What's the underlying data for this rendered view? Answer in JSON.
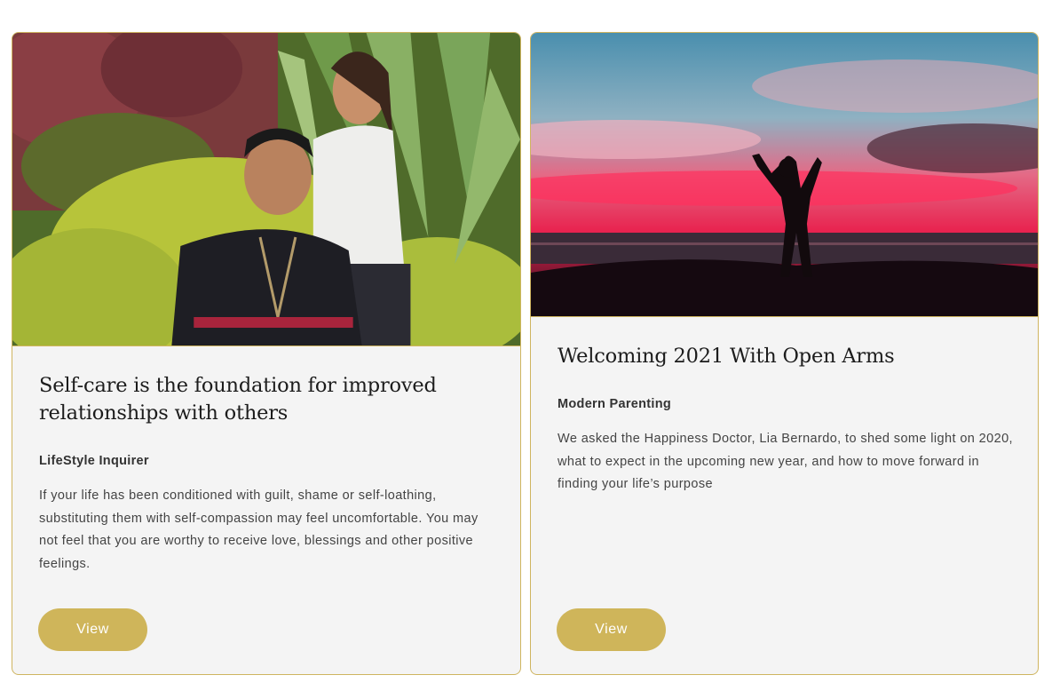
{
  "cards": [
    {
      "title": "Self-care is the foundation for improved relationships with others",
      "source": "LifeStyle Inquirer",
      "excerpt": "If your life has been conditioned with guilt, shame or self-loathing, substituting them with self-compassion may feel uncomfortable. You may not feel that you are worthy to receive love, blessings and other positive feelings.",
      "button_label": "View",
      "image": "photo-two-people-in-garden"
    },
    {
      "title": "Welcoming 2021 With Open Arms",
      "source": "Modern Parenting",
      "excerpt": "We asked the Happiness Doctor, Lia Bernardo, to shed some light on 2020, what to expect in the upcoming new year, and how to move forward in finding your life’s purpose",
      "button_label": "View",
      "image": "photo-silhouette-at-sunset"
    }
  ],
  "colors": {
    "accent": "#cfb55a",
    "card_background": "#f4f4f4",
    "card_border": "#cfb560"
  }
}
